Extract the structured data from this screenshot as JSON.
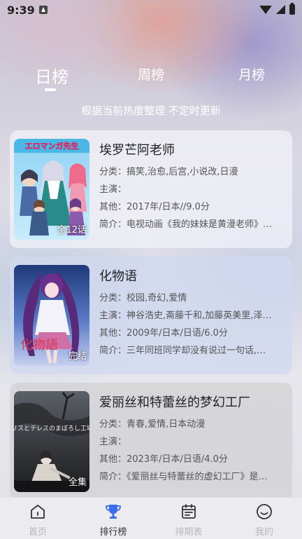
{
  "status_bar": {
    "time": "9:39"
  },
  "tabs": {
    "daily": "日榜",
    "weekly": "周榜",
    "monthly": "月榜",
    "active": "daily"
  },
  "subtitle": "根据当前热度整理 不定时更新",
  "colors": {
    "accent": "#3a6ee8",
    "nav_inactive": "#b8b8bc",
    "text_primary": "#222222"
  },
  "cards": [
    {
      "title": "埃罗芒阿老师",
      "category": "分类：搞笑,治愈,后宫,小说改,日漫",
      "cast": "主演：",
      "other": "其他：2017年/日本//9.0分",
      "intro": "简介：电视动画《我的妹妹是黄漫老师》…",
      "badge": "全12话",
      "cover_text": "エロマンガ先生"
    },
    {
      "title": "化物语",
      "category": "分类：校园,奇幻,爱情",
      "cast": "主演：神谷浩史,斋藤千和,加藤英美里,泽…",
      "other": "其他：2009年/日本/日语/6.0分",
      "intro": "简介：三年同班同学却没有说过一句话,…",
      "badge": "完结",
      "cover_text": "化物語"
    },
    {
      "title": "爱丽丝和特蕾丝的梦幻工厂",
      "category": "分类：青春,爱情,日本动漫",
      "cast": "主演：",
      "other": "其他：2023年/日本/日语/4.0分",
      "intro": "简介：《爱丽丝与特蕾丝的虚幻工厂》是…",
      "badge": "全集",
      "cover_text": "アリスとテレスのまぼろし工場"
    }
  ],
  "bottom_nav": [
    {
      "label": "首页",
      "icon": "home-icon"
    },
    {
      "label": "排行榜",
      "icon": "trophy-icon",
      "active": true
    },
    {
      "label": "排期表",
      "icon": "calendar-icon"
    },
    {
      "label": "我的",
      "icon": "profile-icon"
    }
  ]
}
